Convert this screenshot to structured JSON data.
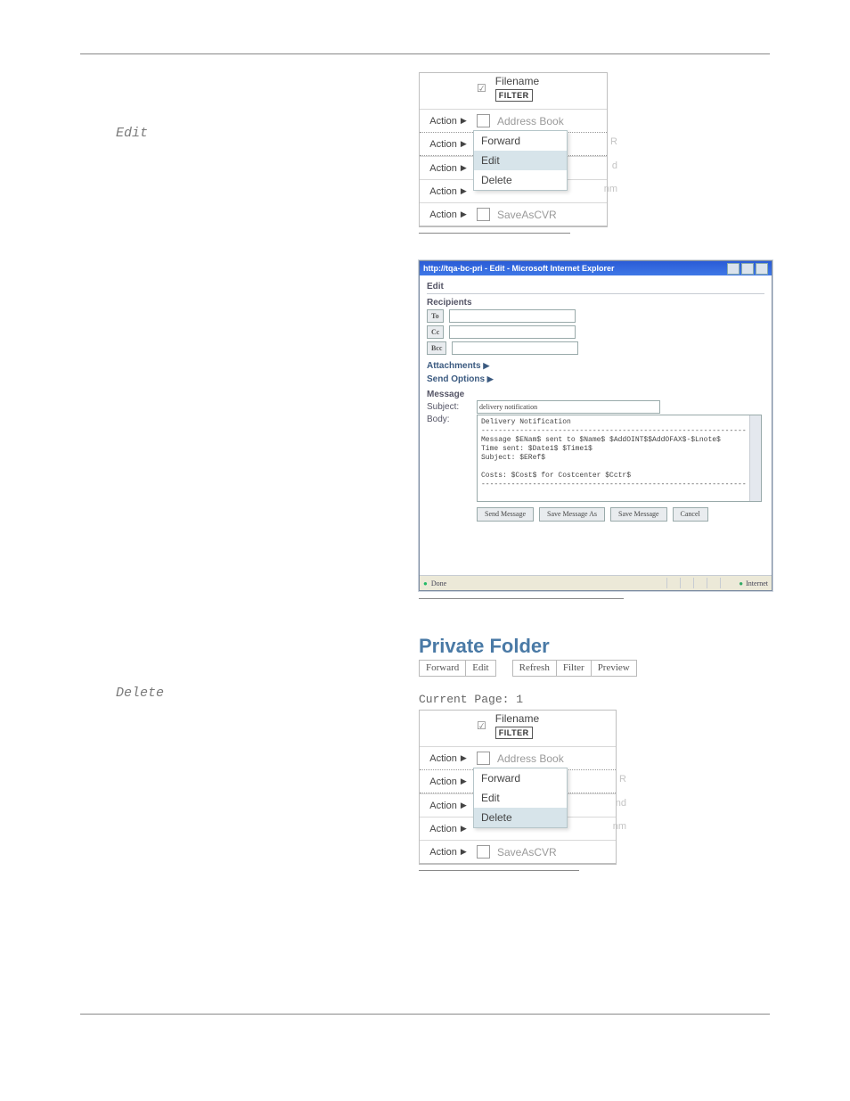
{
  "left_labels": {
    "edit": "Edit",
    "delete": "Delete"
  },
  "menu1": {
    "filename_header": "Filename",
    "filter_badge": "FILTER",
    "address_book": "Address Book",
    "saveascvr": "SaveAsCVR",
    "action": "Action",
    "items": [
      "Forward",
      "Edit",
      "Delete"
    ],
    "highlight": "Edit",
    "ghosts": [
      "R",
      "d",
      "nm"
    ]
  },
  "ie": {
    "title": "http://tqa-bc-pri - Edit - Microsoft Internet Explorer",
    "section_head": "Edit",
    "recipients": "Recipients",
    "to": "To",
    "cc": "Cc",
    "bcc": "Bcc",
    "attachments": "Attachments",
    "send_options": "Send Options",
    "message": "Message",
    "subject_label": "Subject:",
    "subject_value": "delivery notification",
    "body_label": "Body:",
    "body_text": "Delivery Notification\n--------------------------------------------------------------\nMessage $ENam$ sent to $Name$ $AddOINT$$AddOFAX$-$Lnote$\nTime sent: $Date1$ $Time1$\nSubject: $ERef$\n\nCosts: $Cost$ for Costcenter $Cctr$\n--------------------------------------------------------------",
    "buttons": [
      "Send Message",
      "Save Message As",
      "Save Message",
      "Cancel"
    ],
    "status_done": "Done",
    "status_zone": "Internet"
  },
  "pf": {
    "title": "Private Folder",
    "toolbar": [
      "Forward",
      "Edit",
      "Refresh",
      "Filter",
      "Preview"
    ],
    "current_page": "Current Page: 1"
  },
  "menu2": {
    "filename_header": "Filename",
    "filter_badge": "FILTER",
    "address_book": "Address Book",
    "saveascvr": "SaveAsCVR",
    "action": "Action",
    "items": [
      "Forward",
      "Edit",
      "Delete"
    ],
    "highlight": "Delete",
    "ghosts": [
      "R",
      "nd",
      "nm"
    ]
  }
}
